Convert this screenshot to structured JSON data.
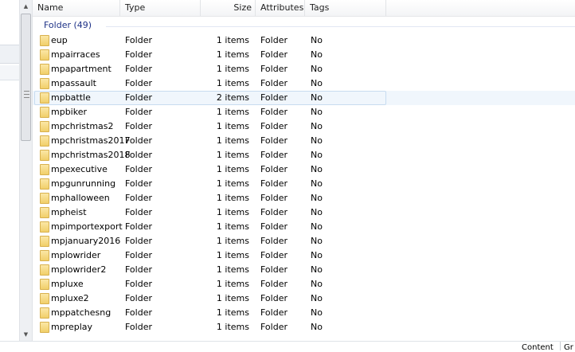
{
  "columns": {
    "name": "Name",
    "type": "Type",
    "size": "Size",
    "attributes": "Attributes",
    "tags": "Tags"
  },
  "group": {
    "label": "Folder (49)"
  },
  "rows": [
    {
      "name": "eup",
      "type": "Folder",
      "size": "1 items",
      "attr": "Folder",
      "tags": "No"
    },
    {
      "name": "mpairraces",
      "type": "Folder",
      "size": "1 items",
      "attr": "Folder",
      "tags": "No"
    },
    {
      "name": "mpapartment",
      "type": "Folder",
      "size": "1 items",
      "attr": "Folder",
      "tags": "No"
    },
    {
      "name": "mpassault",
      "type": "Folder",
      "size": "1 items",
      "attr": "Folder",
      "tags": "No"
    },
    {
      "name": "mpbattle",
      "type": "Folder",
      "size": "2 items",
      "attr": "Folder",
      "tags": "No",
      "selected": true
    },
    {
      "name": "mpbiker",
      "type": "Folder",
      "size": "1 items",
      "attr": "Folder",
      "tags": "No"
    },
    {
      "name": "mpchristmas2",
      "type": "Folder",
      "size": "1 items",
      "attr": "Folder",
      "tags": "No"
    },
    {
      "name": "mpchristmas2017",
      "type": "Folder",
      "size": "1 items",
      "attr": "Folder",
      "tags": "No"
    },
    {
      "name": "mpchristmas2018",
      "type": "Folder",
      "size": "1 items",
      "attr": "Folder",
      "tags": "No"
    },
    {
      "name": "mpexecutive",
      "type": "Folder",
      "size": "1 items",
      "attr": "Folder",
      "tags": "No"
    },
    {
      "name": "mpgunrunning",
      "type": "Folder",
      "size": "1 items",
      "attr": "Folder",
      "tags": "No"
    },
    {
      "name": "mphalloween",
      "type": "Folder",
      "size": "1 items",
      "attr": "Folder",
      "tags": "No"
    },
    {
      "name": "mpheist",
      "type": "Folder",
      "size": "1 items",
      "attr": "Folder",
      "tags": "No"
    },
    {
      "name": "mpimportexport",
      "type": "Folder",
      "size": "1 items",
      "attr": "Folder",
      "tags": "No"
    },
    {
      "name": "mpjanuary2016",
      "type": "Folder",
      "size": "1 items",
      "attr": "Folder",
      "tags": "No"
    },
    {
      "name": "mplowrider",
      "type": "Folder",
      "size": "1 items",
      "attr": "Folder",
      "tags": "No"
    },
    {
      "name": "mplowrider2",
      "type": "Folder",
      "size": "1 items",
      "attr": "Folder",
      "tags": "No"
    },
    {
      "name": "mpluxe",
      "type": "Folder",
      "size": "1 items",
      "attr": "Folder",
      "tags": "No"
    },
    {
      "name": "mpluxe2",
      "type": "Folder",
      "size": "1 items",
      "attr": "Folder",
      "tags": "No"
    },
    {
      "name": "mppatchesng",
      "type": "Folder",
      "size": "1 items",
      "attr": "Folder",
      "tags": "No"
    },
    {
      "name": "mpreplay",
      "type": "Folder",
      "size": "1 items",
      "attr": "Folder",
      "tags": "No"
    }
  ],
  "status": {
    "tab1": "Content",
    "tab2": "Gr"
  },
  "icons": {
    "folder": "folder-icon",
    "scroll_up": "up-arrow-icon",
    "scroll_down": "down-arrow-icon"
  },
  "colors": {
    "group_label": "#1e3287",
    "folder": "#f1cf6a",
    "selection_border": "#c7dcf0"
  }
}
